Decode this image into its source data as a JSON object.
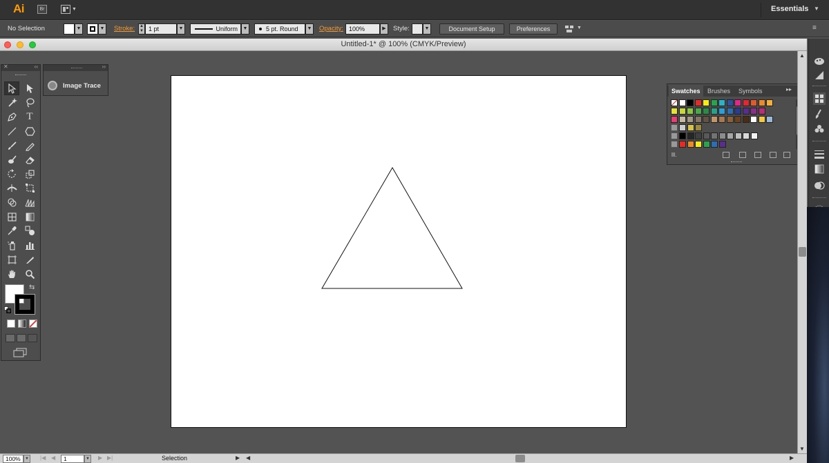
{
  "app": {
    "logo": "Ai",
    "bridge_label": "Br",
    "workspace": "Essentials"
  },
  "control_bar": {
    "selection": "No Selection",
    "stroke_label": "Stroke:",
    "stroke_weight": "1 pt",
    "profile": "Uniform",
    "brush": "5 pt. Round",
    "opacity_label": "Opacity:",
    "opacity": "100%",
    "style_label": "Style:",
    "document_setup": "Document Setup",
    "preferences": "Preferences"
  },
  "document": {
    "title": "Untitled-1* @ 100% (CMYK/Preview)"
  },
  "image_trace": {
    "label": "Image Trace"
  },
  "swatches_panel": {
    "tabs": [
      "Swatches",
      "Brushes",
      "Symbols"
    ],
    "rows": [
      [
        "none",
        "#ffffff",
        "#000000",
        "#e42b24",
        "#f6eb14",
        "#2ba24c",
        "#2cb2c8",
        "#2c4f9e",
        "#e1288a",
        "#e1272f",
        "#e15a2c",
        "#eb8a28",
        "#f4ae3c"
      ],
      [
        "#e6e334",
        "#c6d83c",
        "#8cc63f",
        "#49a848",
        "#2b8a46",
        "#2aa088",
        "#2c9fd8",
        "#2c6db4",
        "#2c3b8e",
        "#592d8c",
        "#8b2f8c",
        "#b82c78"
      ],
      [
        "#e63f74",
        "#c5b9a4",
        "#a39882",
        "#847662",
        "#625445",
        "#c2956b",
        "#a8784f",
        "#8c6039",
        "#6b4323",
        "#4b2c15",
        "#ffffff",
        "#f4c842",
        "#9ab8d8"
      ],
      [
        "#cccccc",
        "#d6c24a",
        "#9e8a3a"
      ],
      [
        "#000000",
        "#262626",
        "#404040",
        "#595959",
        "#737373",
        "#8c8c8c",
        "#a6a6a6",
        "#bfbfbf",
        "#d9d9d9",
        "#f2f2f2"
      ],
      [
        "#e42b24",
        "#eb8a28",
        "#f6eb14",
        "#2ba24c",
        "#2c6db4",
        "#592d8c"
      ]
    ]
  },
  "status_bar": {
    "zoom": "100%",
    "artboard": "1",
    "tool": "Selection"
  },
  "colors": {
    "accent": "#ff9a00",
    "chrome_dark": "#323232",
    "chrome": "#535353"
  }
}
